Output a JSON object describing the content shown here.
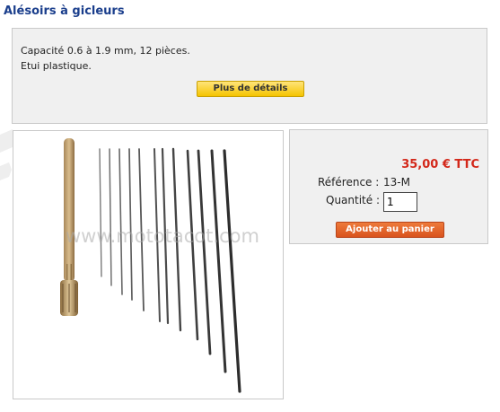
{
  "product": {
    "title": "Alésoirs à gicleurs",
    "description_line1": "Capacité 0.6 à 1.9 mm, 12 pièces.",
    "description_line2": "Etui plastique.",
    "details_button": "Plus de détails",
    "image_watermark": "www.mototacot.com",
    "image_icon": "reamer-set-photo"
  },
  "purchase": {
    "price": "35,00 € TTC",
    "reference_label": "Référence :",
    "reference_value": "13-M",
    "quantity_label": "Quantité :",
    "quantity_value": "1",
    "add_to_cart": "Ajouter au panier"
  },
  "colors": {
    "title": "#1a3e8c",
    "price": "#d3281a",
    "details_button": "#f5c400",
    "cart_button": "#d9531e"
  }
}
